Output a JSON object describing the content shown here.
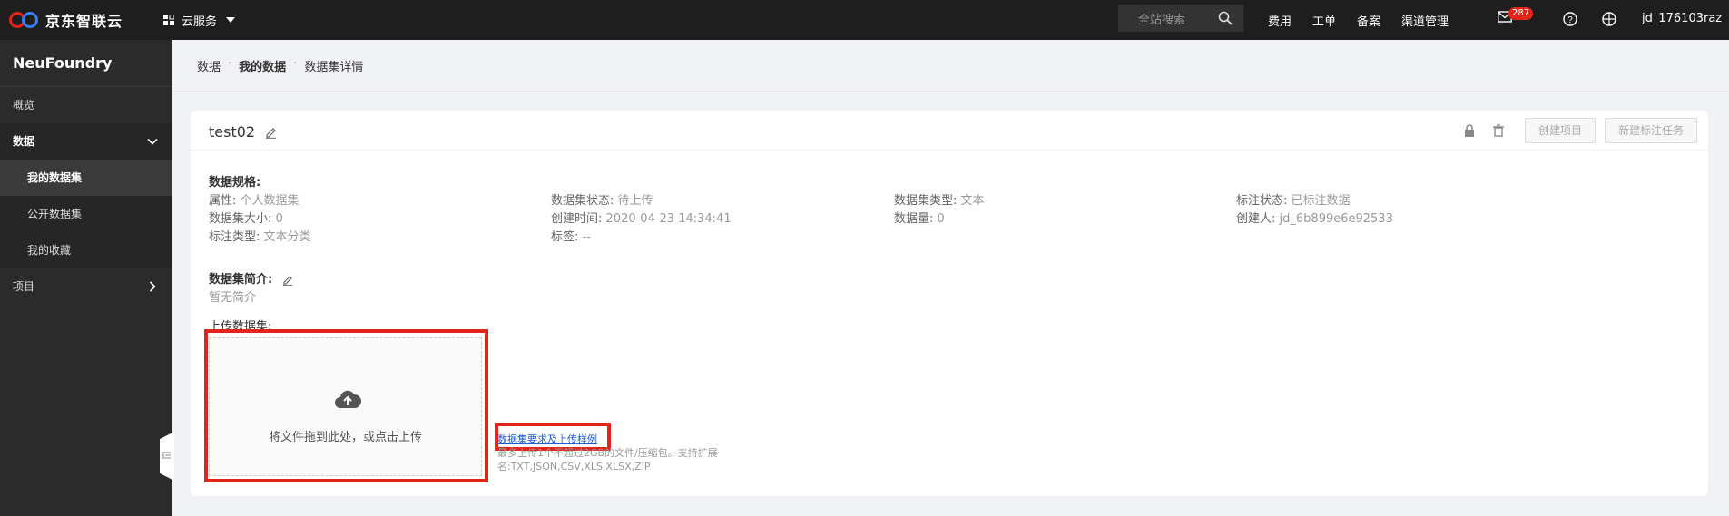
{
  "topbar": {
    "brand": "京东智联云",
    "cloud_service": "云服务",
    "search_placeholder": "全站搜索",
    "nav": [
      "费用",
      "工单",
      "备案",
      "渠道管理"
    ],
    "mail_badge": "287",
    "user": "jd_176103raz"
  },
  "sidebar": {
    "title": "NeuFoundry",
    "overview": "概览",
    "data": "数据",
    "my_datasets": "我的数据集",
    "public_datasets": "公开数据集",
    "my_favorites": "我的收藏",
    "projects": "项目"
  },
  "breadcrumb": [
    "数据",
    "我的数据",
    "数据集详情"
  ],
  "dataset": {
    "name": "test02",
    "create_project": "创建项目",
    "new_label_task": "新建标注任务",
    "spec_label": "数据规格:",
    "fields": {
      "attr_k": "属性:",
      "attr_v": "个人数据集",
      "status_k": "数据集状态:",
      "status_v": "待上传",
      "type_k": "数据集类型:",
      "type_v": "文本",
      "label_status_k": "标注状态:",
      "label_status_v": "已标注数据",
      "size_k": "数据集大小:",
      "size_v": "0",
      "created_k": "创建时间:",
      "created_v": "2020-04-23 14:34:41",
      "count_k": "数据量:",
      "count_v": "0",
      "creator_k": "创建人:",
      "creator_v": "jd_6b899e6e92533",
      "label_type_k": "标注类型:",
      "label_type_v": "文本分类",
      "tags_k": "标签:",
      "tags_v": "--"
    },
    "intro_label": "数据集简介:",
    "intro_value": "暂无简介",
    "upload_label": "上传数据集:",
    "upload_hint": "将文件拖到此处，或点击上传",
    "req_link": "数据集要求及上传样例",
    "req_note": "最多上传1个不超过2GB的文件/压缩包。支持扩展名:TXT,JSON,CSV,XLS,XLSX,ZIP"
  },
  "colors": {
    "topbar": "#1e1e1e",
    "sidebar": "#2b2b2b",
    "highlight": "#e1251b",
    "link": "#1e5bd8"
  }
}
